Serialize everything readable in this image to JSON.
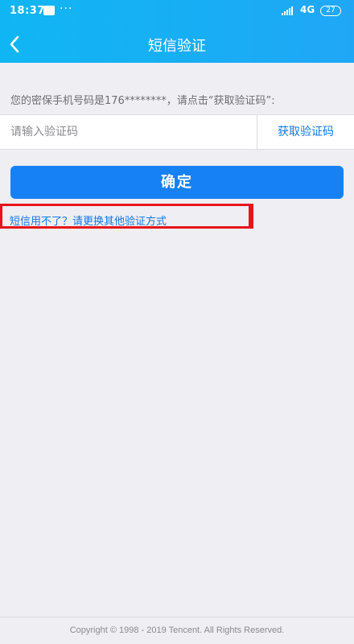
{
  "status_bar": {
    "time": "18:37",
    "dots": "···",
    "network": "4G",
    "battery": "27"
  },
  "header": {
    "title": "短信验证",
    "back_icon": "chevron-left-icon"
  },
  "form": {
    "hint": "您的密保手机号码是176********，请点击“获取验证码”:",
    "code_input": {
      "placeholder": "请输入验证码",
      "value": ""
    },
    "get_code_label": "获取验证码",
    "confirm_label": "确定",
    "alternative_link": "短信用不了？请更换其他验证方式"
  },
  "footer": {
    "copyright": "Copyright © 1998 - 2019 Tencent. All Rights Reserved."
  },
  "colors": {
    "header": "#10b6f3",
    "primary_button": "#1681f5",
    "link": "#1478e6",
    "highlight": "#e8141c",
    "background": "#eeeef3"
  }
}
